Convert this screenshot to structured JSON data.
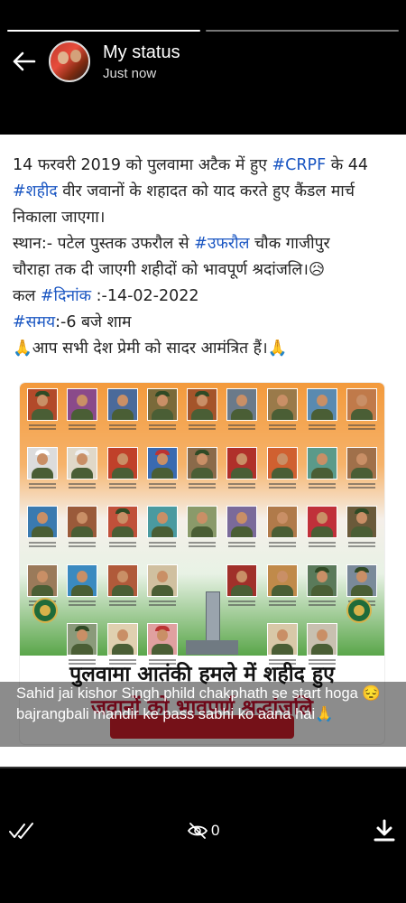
{
  "header": {
    "title": "My status",
    "subtitle": "Just now"
  },
  "post": {
    "line1_a": "14 फरवरी 2019 को पुलवामा अटैक में हुए ",
    "line1_tag": "#CRPF",
    "line1_b": " के 44",
    "line2_tag": "#शहीद",
    "line2_b": " वीर जवानों के शहादत को याद करते हुए कैंडल मार्च",
    "line3": "निकाला जाएगा।",
    "line4_a": "स्थान:- पटेल पुस्तक उफरौल से ",
    "line4_tag": "#उफरौल",
    "line4_b": " चौक गाजीपुर",
    "line5": "चौराहा तक दी जाएगी शहीदों को भावपूर्ण श्रदांजलि।😥",
    "line6_a": "कल ",
    "line6_tag": "#दिनांक",
    "line6_b": " :-14-02-2022",
    "line7_tag": "#समय",
    "line7_b": ":-6 बजे शाम",
    "line8": " 🙏आप सभी देश प्रेमी को सादर आमंत्रित हैं।🙏"
  },
  "poster": {
    "headline_line1": "पुलवामा आतंकी हमले में शहीद हुए",
    "headline_line2": "जवानों को भावपूर्ण श्रद्धांजलि"
  },
  "caption": {
    "text": "Sahid jai kishor Singh phild chakphath se start hoga 😔 bajrangbali mandir ke pass sabhi ko aana hai🙏"
  },
  "footer": {
    "view_count": "0"
  },
  "icons": [
    "back-arrow-icon",
    "double-check-icon",
    "eye-off-icon",
    "download-icon"
  ],
  "colors": {
    "background": "#000000",
    "hashtag": "#1a56c2",
    "headline_red": "#c8102e"
  }
}
